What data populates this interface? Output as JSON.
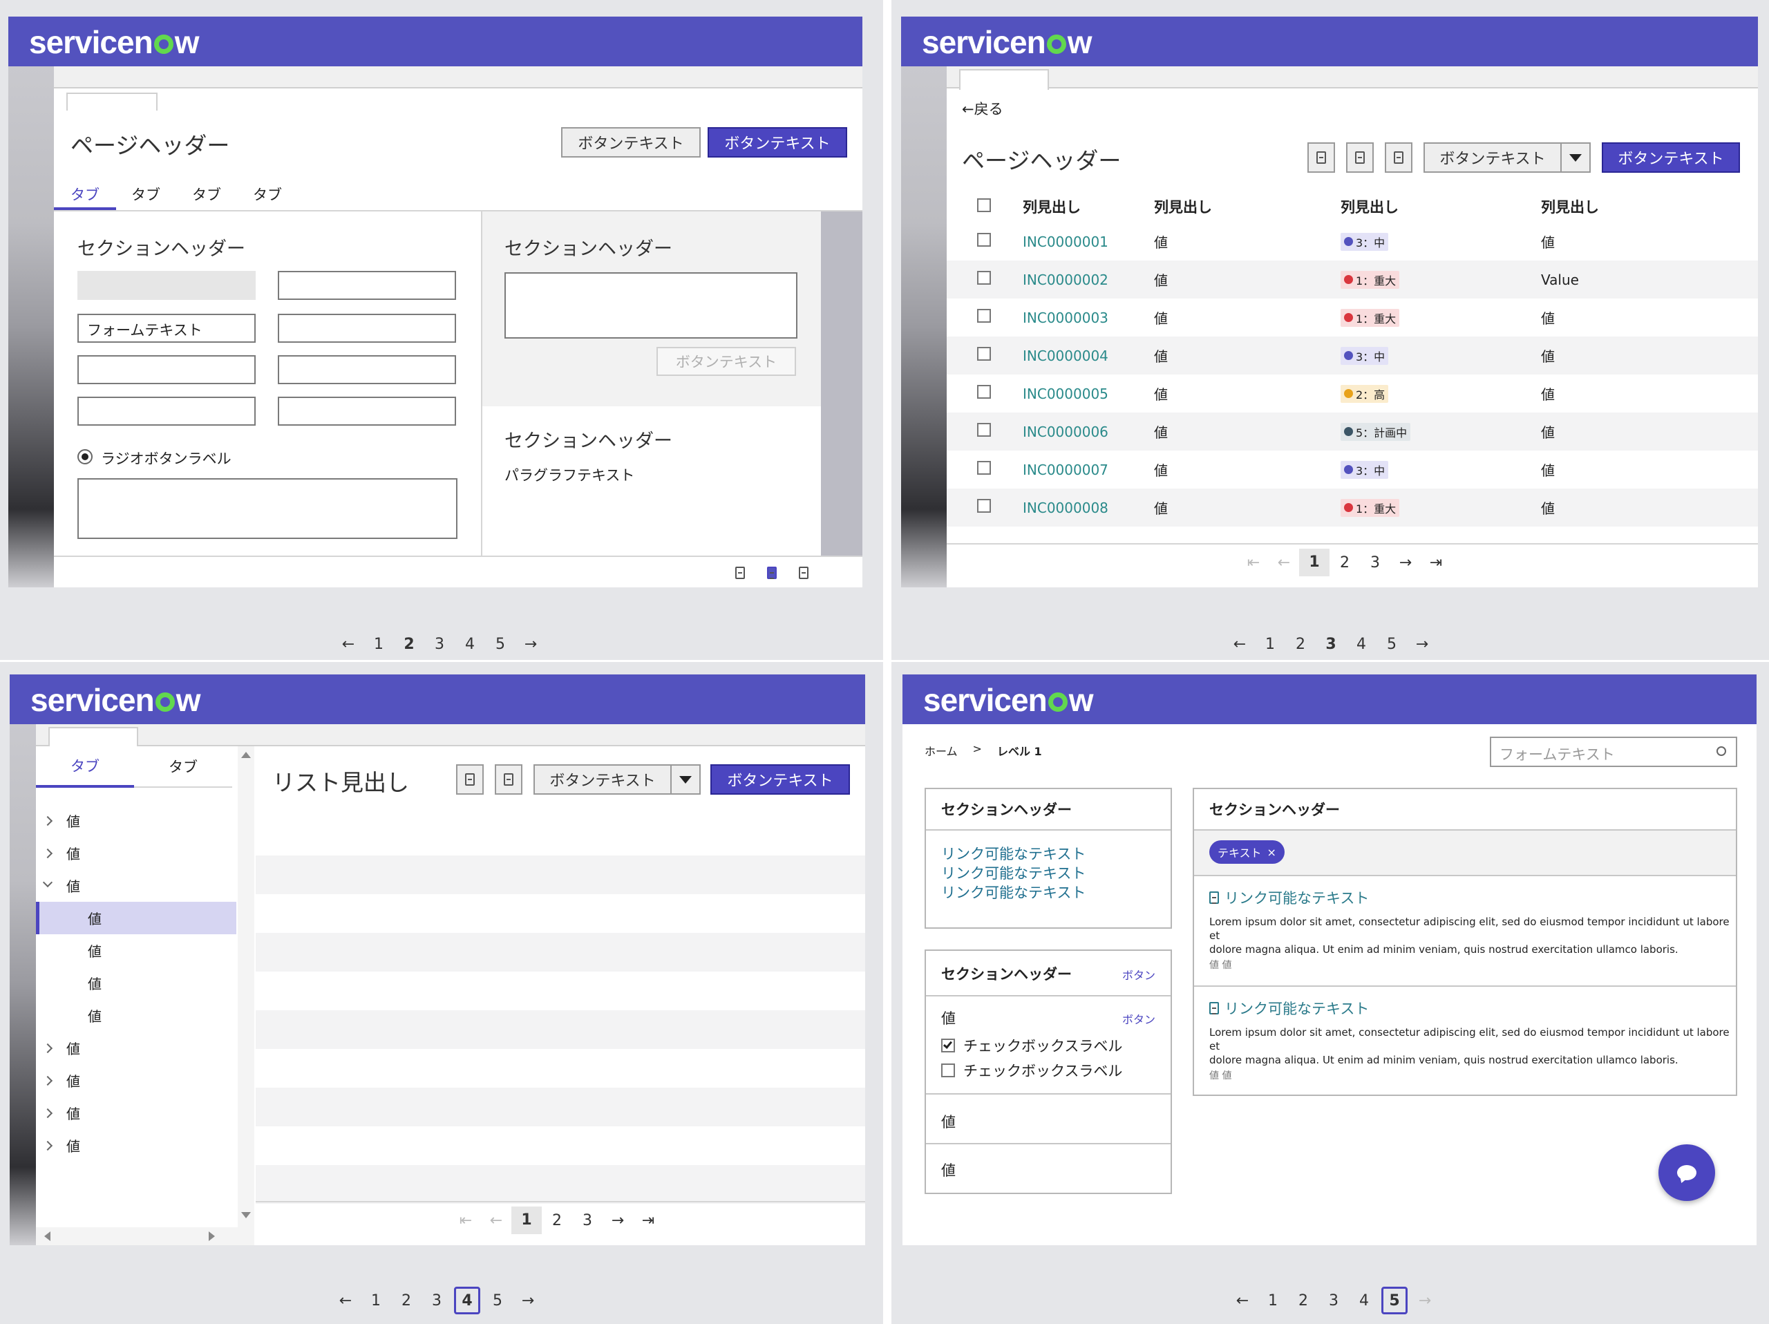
{
  "brand": {
    "text_pre": "servicen",
    "text_post": "w",
    "colors": {
      "brand": "#5352be",
      "o": "#62d84e"
    }
  },
  "q1": {
    "title": "ページヘッダー",
    "btn_secondary": "ボタンテキスト",
    "btn_primary": "ボタンテキスト",
    "tabs": [
      "タブ",
      "タブ",
      "タブ",
      "タブ"
    ],
    "section_left": "セクションヘッダー",
    "form_text": "フォームテキスト",
    "radio_label": "ラジオボタンラベル",
    "section_right1": "セクションヘッダー",
    "disabled_btn": "ボタンテキスト",
    "section_right2": "セクションヘッダー",
    "paragraph": "パラグラフテキスト",
    "icons": [
      "doc-icon",
      "doc-filled-icon",
      "doc-icon"
    ],
    "pagination": [
      "←",
      "1",
      "2",
      "3",
      "4",
      "5",
      "→"
    ],
    "current_page": "2"
  },
  "q2": {
    "back": "←戻る",
    "title": "ページヘッダー",
    "btn_secondary": "ボタンテキスト",
    "btn_primary": "ボタンテキスト",
    "headers": [
      "列見出し",
      "列見出し",
      "列見出し",
      "列見出し"
    ],
    "rows": [
      {
        "id": "INC0000001",
        "v1": "値",
        "badge": "3：中",
        "badge_color": "#5352be",
        "badge_bg": "#e3e2f7",
        "v2": "値"
      },
      {
        "id": "INC0000002",
        "v1": "値",
        "badge": "1：重大",
        "badge_color": "#d9363e",
        "badge_bg": "#f9dcdd",
        "v2": "Value"
      },
      {
        "id": "INC0000003",
        "v1": "値",
        "badge": "1：重大",
        "badge_color": "#d9363e",
        "badge_bg": "#f9dcdd",
        "v2": "値"
      },
      {
        "id": "INC0000004",
        "v1": "値",
        "badge": "3：中",
        "badge_color": "#5352be",
        "badge_bg": "#e3e2f7",
        "v2": "値"
      },
      {
        "id": "INC0000005",
        "v1": "値",
        "badge": "2：高",
        "badge_color": "#e8a21a",
        "badge_bg": "#fbeccd",
        "v2": "値"
      },
      {
        "id": "INC0000006",
        "v1": "値",
        "badge": "5：計画中",
        "badge_color": "#3b5566",
        "badge_bg": "#e2e7ea",
        "v2": "値"
      },
      {
        "id": "INC0000007",
        "v1": "値",
        "badge": "3：中",
        "badge_color": "#5352be",
        "badge_bg": "#e3e2f7",
        "v2": "値"
      },
      {
        "id": "INC0000008",
        "v1": "値",
        "badge": "1：重大",
        "badge_color": "#d9363e",
        "badge_bg": "#f9dcdd",
        "v2": "値"
      }
    ],
    "inner_pagination": [
      "⇤",
      "←",
      "1",
      "2",
      "3",
      "→",
      "⇥"
    ],
    "inner_current": "1",
    "pagination": [
      "←",
      "1",
      "2",
      "3",
      "4",
      "5",
      "→"
    ],
    "current_page": "3"
  },
  "q3": {
    "tabs": [
      "タブ",
      "タブ"
    ],
    "tree": [
      {
        "label": "値",
        "level": 0,
        "state": "collapsed"
      },
      {
        "label": "値",
        "level": 0,
        "state": "collapsed"
      },
      {
        "label": "値",
        "level": 0,
        "state": "expanded"
      },
      {
        "label": "値",
        "level": 1,
        "state": "selected"
      },
      {
        "label": "値",
        "level": 1,
        "state": "leaf"
      },
      {
        "label": "値",
        "level": 1,
        "state": "leaf"
      },
      {
        "label": "値",
        "level": 1,
        "state": "leaf"
      },
      {
        "label": "値",
        "level": 0,
        "state": "collapsed"
      },
      {
        "label": "値",
        "level": 0,
        "state": "collapsed"
      },
      {
        "label": "値",
        "level": 0,
        "state": "collapsed"
      },
      {
        "label": "値",
        "level": 0,
        "state": "collapsed"
      }
    ],
    "title": "リスト見出し",
    "btn_secondary": "ボタンテキスト",
    "btn_primary": "ボタンテキスト",
    "inner_pagination": [
      "⇤",
      "←",
      "1",
      "2",
      "3",
      "→",
      "⇥"
    ],
    "inner_current": "1",
    "pagination": [
      "←",
      "1",
      "2",
      "3",
      "4",
      "5",
      "→"
    ],
    "current_page": "4"
  },
  "q4": {
    "breadcrumb_home": "ホーム",
    "breadcrumb_sep": ">",
    "breadcrumb_level": "レベル 1",
    "search_placeholder": "フォームテキスト",
    "card1_header": "セクションヘッダー",
    "card1_links": [
      "リンク可能なテキスト",
      "リンク可能なテキスト",
      "リンク可能なテキスト"
    ],
    "card2_header": "セクションヘッダー",
    "card2_button": "ボタン",
    "card2_value": "値",
    "card2_button2": "ボタン",
    "checkbox1": "チェックボックスラベル",
    "checkbox2": "チェックボックスラベル",
    "card2_row1": "値",
    "card2_row2": "値",
    "card3_header": "セクションヘッダー",
    "pill": "テキスト",
    "results": [
      {
        "title": "リンク可能なテキスト",
        "body1": "Lorem ipsum dolor sit amet, consectetur adipiscing elit, sed do eiusmod tempor incididunt ut labore et",
        "body2": "dolore magna aliqua. Ut enim ad minim veniam, quis nostrud exercitation ullamco laboris.",
        "meta": "値 値"
      },
      {
        "title": "リンク可能なテキスト",
        "body1": "Lorem ipsum dolor sit amet, consectetur adipiscing elit, sed do eiusmod tempor incididunt ut labore et",
        "body2": "dolore magna aliqua. Ut enim ad minim veniam, quis nostrud exercitation ullamco laboris.",
        "meta": "値 値"
      }
    ],
    "pagination": [
      "←",
      "1",
      "2",
      "3",
      "4",
      "5",
      "→"
    ],
    "current_page": "5"
  }
}
